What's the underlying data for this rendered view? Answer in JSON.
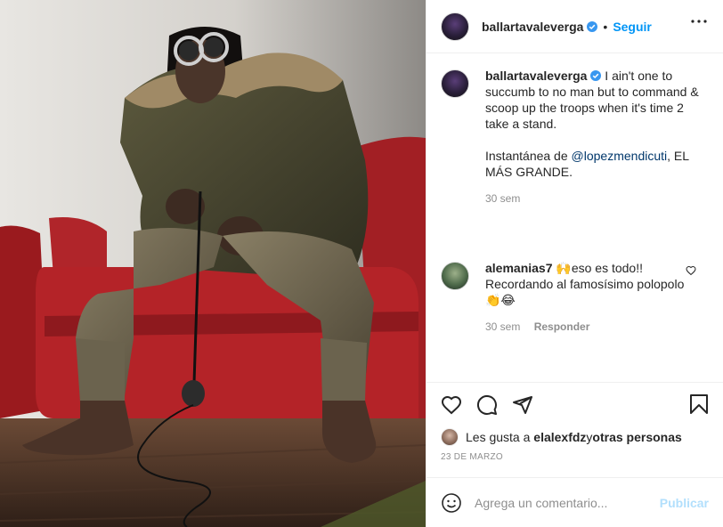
{
  "post": {
    "author": "ballartavaleverga",
    "verified": true,
    "follow_label": "Seguir",
    "caption_line1": "I ain't one to succumb to no man but to command & scoop up the troops when it's time 2 take a stand.",
    "caption_line2_prefix": "Instantánea de ",
    "caption_mention": "@lopezmendicuti",
    "caption_line2_suffix": ", EL MÁS GRANDE.",
    "caption_age": "30 sem"
  },
  "comments": [
    {
      "author": "alemanias7",
      "text": "🙌eso es todo!! Recordando al famosísimo polopolo👏😂",
      "age": "30 sem",
      "reply_label": "Responder"
    }
  ],
  "likes": {
    "prefix": "Les gusta a ",
    "user": "elalexfdz",
    "middle": " y ",
    "others": "otras personas"
  },
  "date": "23 DE MARZO",
  "add_comment": {
    "placeholder": "Agrega un comentario...",
    "publish_label": "Publicar"
  },
  "icons": {
    "more": "more-horizontal-icon",
    "like": "heart-icon",
    "comment": "comment-icon",
    "share": "paper-plane-icon",
    "save": "bookmark-icon",
    "emoji": "smiley-icon"
  },
  "colors": {
    "accent": "#0095f6",
    "publish_disabled": "#b2dffc",
    "muted": "#8e8e8e"
  }
}
